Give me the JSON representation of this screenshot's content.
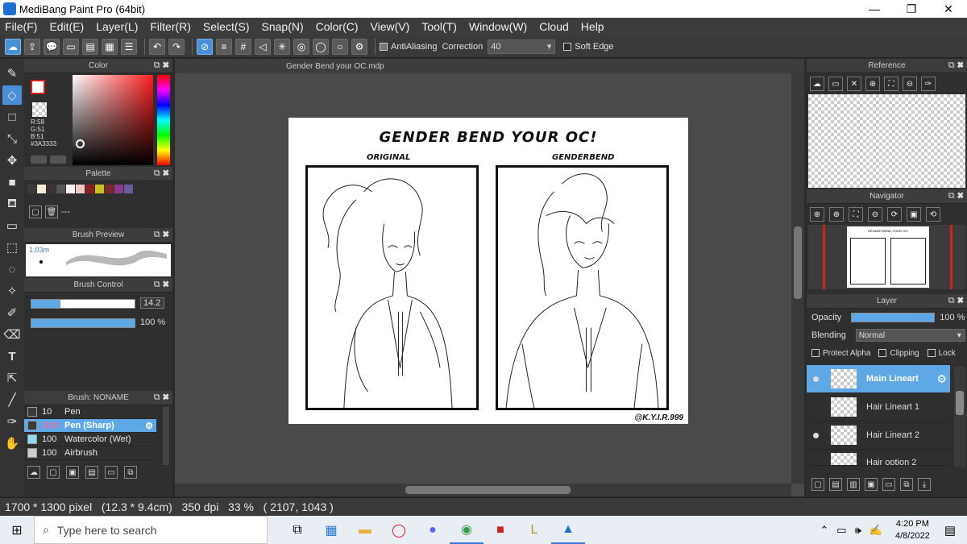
{
  "window": {
    "title": "MediBang Paint Pro (64bit)",
    "minimize": "—",
    "restore": "❐",
    "close": "✕"
  },
  "menu": [
    "File(F)",
    "Edit(E)",
    "Layer(L)",
    "Filter(R)",
    "Select(S)",
    "Snap(N)",
    "Color(C)",
    "View(V)",
    "Tool(T)",
    "Window(W)",
    "Cloud",
    "Help"
  ],
  "toolbar": {
    "antialiasing_label": "AntiAliasing",
    "antialiasing_checked": true,
    "correction_label": "Correction",
    "correction_value": "40",
    "soft_edge_label": "Soft Edge",
    "soft_edge_checked": false
  },
  "panels": {
    "color": {
      "title": "Color",
      "rgb_text": "R:58\nG:51\nB:51\n#3A3333",
      "accent": "#d62020"
    },
    "palette": {
      "title": "Palette",
      "colors": [
        "#3a3a3a",
        "#f5ead8",
        "#3d3333",
        "#555555",
        "#f6f0f0",
        "#f0c8c8",
        "#8c2020",
        "#c8c020",
        "#7a2a2a",
        "#8a3a8a",
        "#6a5a9a"
      ],
      "label": "---"
    },
    "brush_preview": {
      "title": "Brush Preview",
      "size": "1.03m"
    },
    "brush_control": {
      "title": "Brush Control",
      "size_value": "14.2",
      "size_fraction": 0.28,
      "opacity_value": "100 %",
      "opacity_fraction": 1.0
    },
    "brush": {
      "title": "Brush: NONAME",
      "items": [
        {
          "size": "10",
          "name": "Pen",
          "color": "#3a3a3a"
        },
        {
          "size": "10.0",
          "name": "Pen (Sharp)",
          "color": "#3a3a3a",
          "selected": true
        },
        {
          "size": "100",
          "name": "Watercolor (Wet)",
          "color": "#8fdaf5"
        },
        {
          "size": "100",
          "name": "Airbrush",
          "color": "#cccccc"
        }
      ]
    },
    "reference": {
      "title": "Reference"
    },
    "navigator": {
      "title": "Navigator",
      "thumb_title": "GENDER BEND YOUR OC!"
    },
    "layer": {
      "title": "Layer",
      "opacity_label": "Opacity",
      "opacity_value": "100 %",
      "opacity_fraction": 1.0,
      "blending_label": "Blending",
      "blending_value": "Normal",
      "protect_alpha": "Protect Alpha",
      "clipping": "Clipping",
      "lock": "Lock",
      "layers": [
        {
          "name": "Main Lineart",
          "visible": true,
          "selected": true
        },
        {
          "name": "Hair Lineart 1",
          "visible": false
        },
        {
          "name": "Hair Lineart 2",
          "visible": true
        },
        {
          "name": "Hair option 2",
          "visible": false
        }
      ]
    }
  },
  "document": {
    "tab": "Gender Bend your OC.mdp",
    "title": "GENDER BEND YOUR OC!",
    "label_left": "ORIGINAL",
    "label_right": "GENDERBEND",
    "credit": "@K.Y.I.R.999"
  },
  "status": {
    "text": "1700 * 1300 pixel   (12.3 * 9.4cm)   350 dpi   33 %   ( 2107, 1043 )"
  },
  "taskbar": {
    "search_placeholder": "Type here to search",
    "time": "4:20 PM",
    "date": "4/8/2022"
  }
}
